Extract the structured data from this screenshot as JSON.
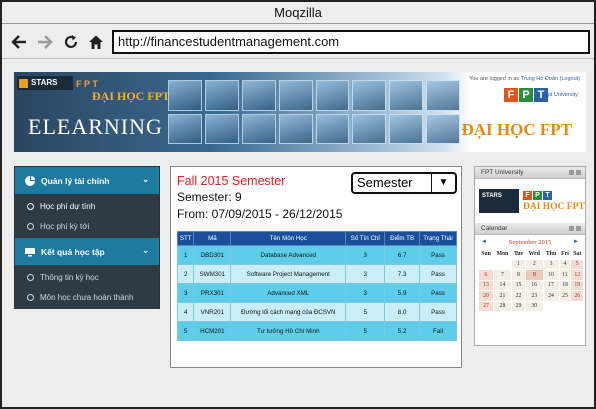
{
  "window": {
    "title": "Moqzilla"
  },
  "browser": {
    "url": "http://financestudentmanagement.com"
  },
  "banner": {
    "stars": "STARS",
    "fpt_small": "F P T",
    "daihoc_left": "ĐẠI HỌC FPT",
    "elearning": "ELEARNING",
    "login_prefix": "You are logged in as",
    "login_user": "Trung Hồ Đoàn (Logout)",
    "fpt_logo": [
      "F",
      "P",
      "T"
    ],
    "fpt_university": "Fpt University",
    "daihoc_right": "ĐẠI HỌC FPT",
    "colors": {
      "f": "#e0541e",
      "p": "#2e8b3d",
      "t": "#2a62a8"
    }
  },
  "sidebar": {
    "sections": [
      {
        "label": "Quản lý tài chính",
        "icon": "pie-chart-icon",
        "items": [
          {
            "label": "Học phí dự tính",
            "active": true
          },
          {
            "label": "Học phí kỳ tới",
            "active": false
          }
        ]
      },
      {
        "label": "Kết quả học tập",
        "icon": "monitor-icon",
        "items": [
          {
            "label": "Thông tin kỳ học",
            "active": false
          },
          {
            "label": "Môn học chưa hoàn thành",
            "active": false
          }
        ]
      }
    ]
  },
  "main": {
    "semester_title": "Fall 2015 Semester",
    "semester_number": "Semester: 9",
    "semester_range": "From: 07/09/2015 - 26/12/2015",
    "semester_select": "Semester",
    "table": {
      "headers": [
        "STT",
        "Mã",
        "Tên Môn Học",
        "Số Tín Chỉ",
        "Điểm TB",
        "Trạng Thái"
      ],
      "rows": [
        [
          "1",
          "DBD301",
          "Database Advanced",
          "3",
          "6.7",
          "Pass"
        ],
        [
          "2",
          "SWM301",
          "Software Project Management",
          "3",
          "7.3",
          "Pass"
        ],
        [
          "3",
          "PRX301",
          "Advanced XML",
          "3",
          "5.9",
          "Pass"
        ],
        [
          "4",
          "VNR201",
          "Đường lối cách mạng của ĐCSVN",
          "5",
          "8.0",
          "Pass"
        ],
        [
          "5",
          "HCM201",
          "Tư tưởng Hồ Chí Minh",
          "5",
          "5.2",
          "Fail"
        ]
      ]
    }
  },
  "right_panel": {
    "fpt_title": "FPT University",
    "calendar_title": "Calendar",
    "month": "September 2015",
    "prev": "◄",
    "next": "►",
    "weekdays": [
      "Sun",
      "Mon",
      "Tue",
      "Wed",
      "Thu",
      "Fri",
      "Sat"
    ],
    "weeks": [
      [
        "",
        "",
        "1",
        "2",
        "3",
        "4",
        "5"
      ],
      [
        "6",
        "7",
        "8",
        "9",
        "10",
        "11",
        "12"
      ],
      [
        "13",
        "14",
        "15",
        "16",
        "17",
        "18",
        "19"
      ],
      [
        "20",
        "21",
        "22",
        "23",
        "24",
        "25",
        "26"
      ],
      [
        "27",
        "28",
        "29",
        "30",
        "",
        "",
        ""
      ]
    ]
  }
}
